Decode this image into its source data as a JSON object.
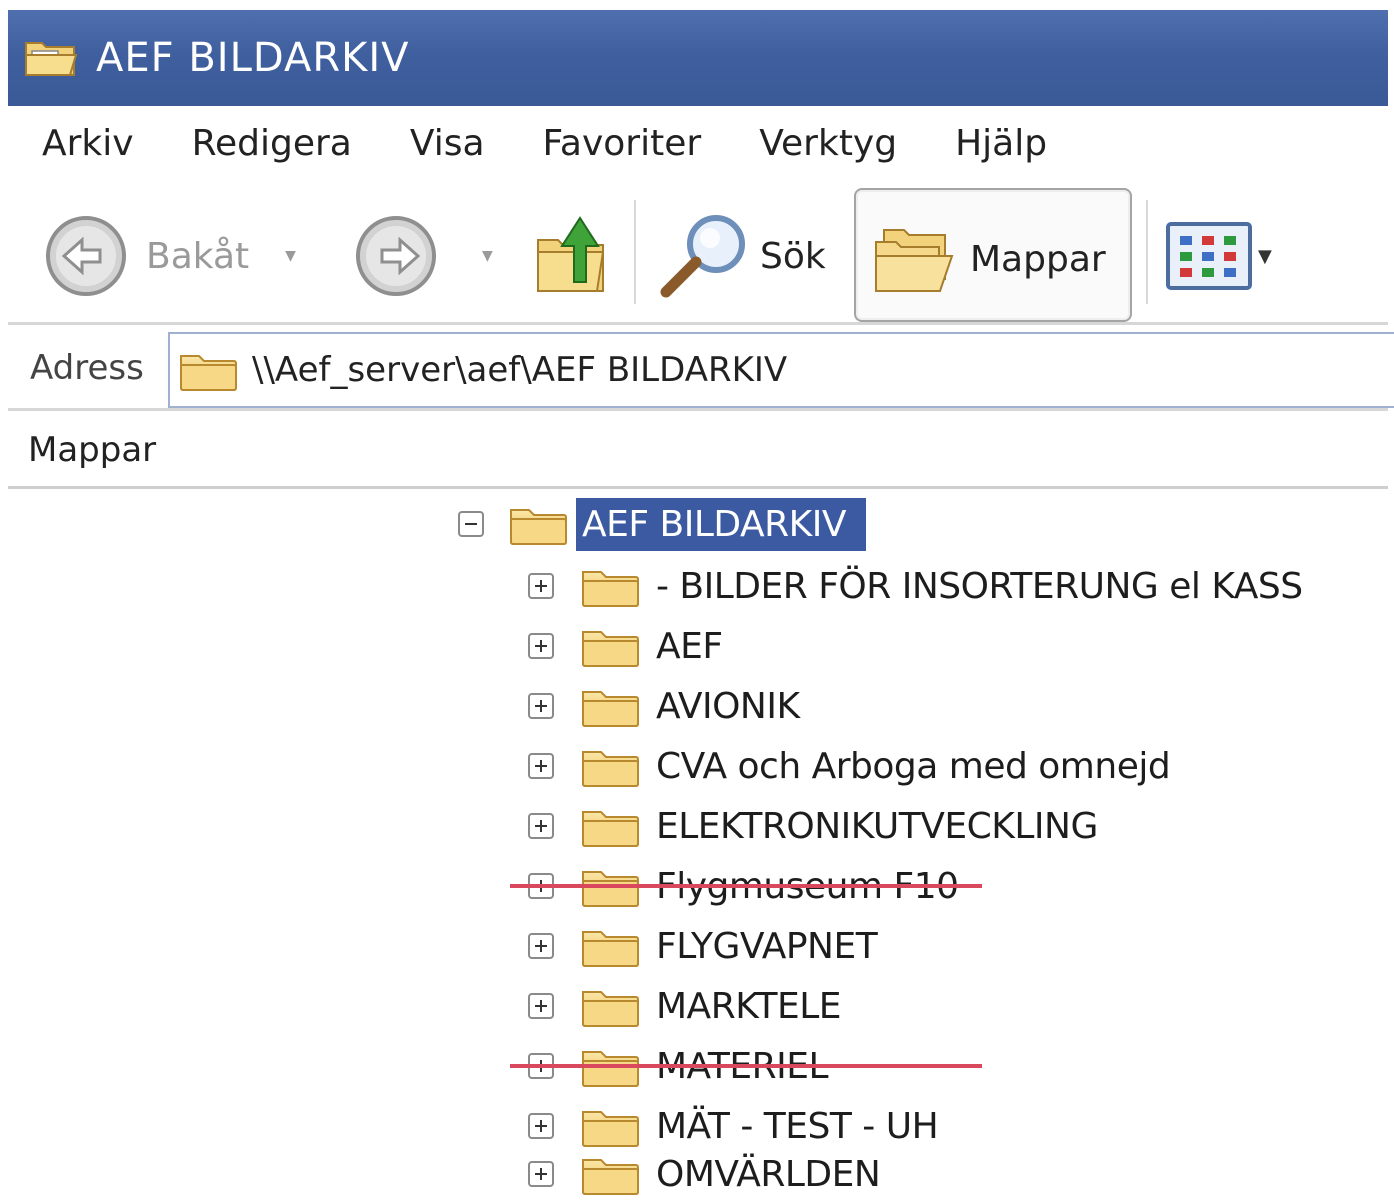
{
  "window": {
    "title": "AEF BILDARKIV",
    "title_icon": "folder-window-icon"
  },
  "menu": [
    "Arkiv",
    "Redigera",
    "Visa",
    "Favoriter",
    "Verktyg",
    "Hjälp"
  ],
  "toolbar": {
    "back_label": "Bakåt",
    "search_label": "Sök",
    "folders_label": "Mappar"
  },
  "address": {
    "label": "Adress",
    "value": "\\\\Aef_server\\aef\\AEF BILDARKIV"
  },
  "folders_pane": {
    "title": "Mappar"
  },
  "tree": {
    "root": "AEF BILDARKIV",
    "items": [
      {
        "label": "- BILDER FÖR INSORTERUNG el KASS",
        "struck": false
      },
      {
        "label": "AEF",
        "struck": false
      },
      {
        "label": "AVIONIK",
        "struck": false
      },
      {
        "label": "CVA och Arboga med omnejd",
        "struck": false
      },
      {
        "label": "ELEKTRONIKUTVECKLING",
        "struck": false
      },
      {
        "label": "Flygmuseum F10",
        "struck": true
      },
      {
        "label": "FLYGVAPNET",
        "struck": false
      },
      {
        "label": "MARKTELE",
        "struck": false
      },
      {
        "label": "MATERIEL",
        "struck": true
      },
      {
        "label": "MÄT - TEST - UH",
        "struck": false
      },
      {
        "label": "OMVÄRLDEN",
        "struck": false
      }
    ]
  },
  "colors": {
    "titlebar": "#3f5f9f",
    "selection": "#3b5aa2",
    "strike": "#d9485d",
    "folder": "#f2cf73"
  }
}
